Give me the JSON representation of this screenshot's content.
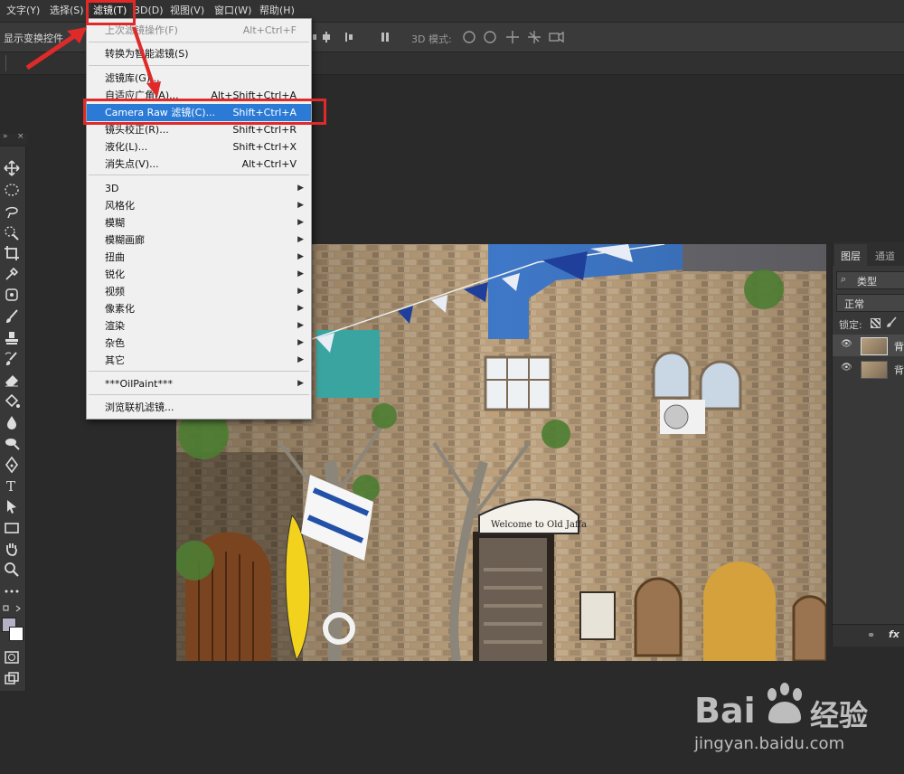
{
  "menubar": {
    "items": [
      {
        "label": "文字(Y)"
      },
      {
        "label": "选择(S)"
      },
      {
        "label": "滤镜(T)"
      },
      {
        "label": "3D(D)"
      },
      {
        "label": "视图(V)"
      },
      {
        "label": "窗口(W)"
      },
      {
        "label": "帮助(H)"
      }
    ]
  },
  "options_bar": {
    "show_transform_label": "显示变换控件",
    "mode_3d_label": "3D 模式:"
  },
  "filter_menu": {
    "items": [
      {
        "label": "上次滤镜操作(F)",
        "shortcut": "Alt+Ctrl+F",
        "disabled": true
      },
      {
        "label": "转换为智能滤镜(S)",
        "shortcut": ""
      },
      {
        "label": "滤镜库(G)...",
        "shortcut": ""
      },
      {
        "label": "自适应广角(A)...",
        "shortcut": "Alt+Shift+Ctrl+A"
      },
      {
        "label": "Camera Raw 滤镜(C)...",
        "shortcut": "Shift+Ctrl+A",
        "highlighted": true
      },
      {
        "label": "镜头校正(R)...",
        "shortcut": "Shift+Ctrl+R"
      },
      {
        "label": "液化(L)...",
        "shortcut": "Shift+Ctrl+X"
      },
      {
        "label": "消失点(V)...",
        "shortcut": "Alt+Ctrl+V"
      },
      {
        "label": "3D",
        "submenu": true
      },
      {
        "label": "风格化",
        "submenu": true
      },
      {
        "label": "模糊",
        "submenu": true
      },
      {
        "label": "模糊画廊",
        "submenu": true
      },
      {
        "label": "扭曲",
        "submenu": true
      },
      {
        "label": "锐化",
        "submenu": true
      },
      {
        "label": "视频",
        "submenu": true
      },
      {
        "label": "像素化",
        "submenu": true
      },
      {
        "label": "渲染",
        "submenu": true
      },
      {
        "label": "杂色",
        "submenu": true
      },
      {
        "label": "其它",
        "submenu": true
      },
      {
        "label": "***OilPaint***",
        "submenu": true
      },
      {
        "label": "浏览联机滤镜..."
      }
    ]
  },
  "layers_panel": {
    "tab_layers": "图层",
    "tab_channels": "通道",
    "filter_kind": "类型",
    "blend_mode": "正常",
    "lock_label": "锁定:",
    "layers": [
      {
        "name": "背"
      },
      {
        "name": "背"
      }
    ],
    "fx_label": "fx"
  },
  "photo": {
    "sign_text": "Welcome to Old Jaffa"
  },
  "watermark": {
    "brand": "Bai",
    "brand2": "经验",
    "url": "jingyan.baidu.com"
  },
  "colors": {
    "highlight": "#2b7bd6",
    "annotation_red": "#e02a2a"
  }
}
